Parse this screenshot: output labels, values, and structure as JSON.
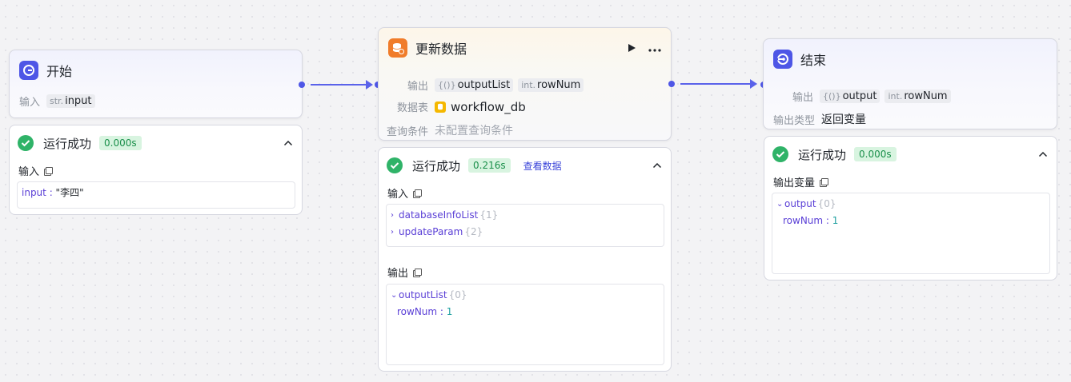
{
  "colors": {
    "accent": "#4e56e6",
    "orange": "#f07c2a",
    "success": "#2fb368",
    "success_badge_bg": "#d8f4e0"
  },
  "start_node": {
    "title": "开始",
    "icon": "start-icon",
    "input_label": "输入",
    "input_tag": {
      "type": "str.",
      "name": "input"
    }
  },
  "update_node": {
    "title": "更新数据",
    "icon": "database-update-icon",
    "output_label": "输出",
    "outputs": [
      {
        "type": "{()}",
        "name": "outputList"
      },
      {
        "type": "int.",
        "name": "rowNum"
      }
    ],
    "table_label": "数据表",
    "table_value": "workflow_db",
    "condition_label": "查询条件",
    "condition_value": "未配置查询条件"
  },
  "end_node": {
    "title": "结束",
    "icon": "end-icon",
    "output_label": "输出",
    "outputs": [
      {
        "type": "{()}",
        "name": "output"
      },
      {
        "type": "int.",
        "name": "rowNum"
      }
    ],
    "output_type_label": "输出类型",
    "output_type_value": "返回变量"
  },
  "start_result": {
    "status": "运行成功",
    "time": "0.000s",
    "input_section": "输入",
    "input_key": "input",
    "input_sep": " : ",
    "input_value": "\"李四\""
  },
  "update_result": {
    "status": "运行成功",
    "time": "0.216s",
    "view_link": "查看数据",
    "input_section": "输入",
    "input_items": [
      {
        "key": "databaseInfoList",
        "count": "{1}"
      },
      {
        "key": "updateParam",
        "count": "{2}"
      }
    ],
    "output_section": "输出",
    "output_list_key": "outputList",
    "output_list_count": "{0}",
    "row_num_key": "rowNum",
    "row_num_sep": " : ",
    "row_num_value": "1"
  },
  "end_result": {
    "status": "运行成功",
    "time": "0.000s",
    "section": "输出变量",
    "output_key": "output",
    "output_count": "{0}",
    "row_num_key": "rowNum",
    "row_num_sep": " : ",
    "row_num_value": "1"
  }
}
